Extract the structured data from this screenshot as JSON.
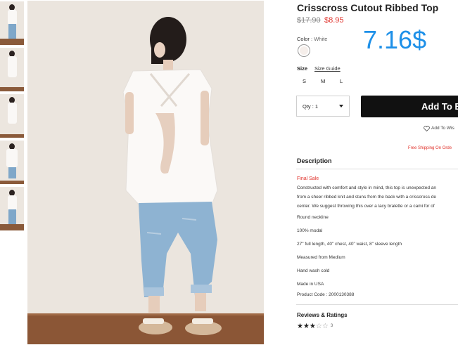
{
  "product": {
    "title": "Crisscross Cutout Ribbed Top",
    "price_original": "$17.90",
    "price_sale": "$8.95",
    "overlay_price": "7.16$",
    "color_label": "Color",
    "color_value": ": White",
    "swatch_color": "#f5eeea",
    "size_label": "Size",
    "size_guide": "Size Guide",
    "sizes": [
      "S",
      "M",
      "L"
    ],
    "qty_label": "Qty : 1",
    "add_button": "Add To B",
    "wishlist": "Add To Wis",
    "free_shipping": "Free Shipping On Orde"
  },
  "description": {
    "title": "Description",
    "final_sale": "Final Sale",
    "lines": [
      "Constructed with comfort and style in mind, this top is unexpected an",
      "from a sheer ribbed knit and stuns from the back with a crisscross de",
      "center. We suggest throwing this over a lacy bralette or a cami for of",
      "Round neckline",
      "100% modal",
      "27\" full length, 40\" chest, 40\" waist, 8\" sleeve length",
      "Measured from Medium",
      "Hand wash cold",
      "Made in USA",
      "Product Code : 2000130388"
    ]
  },
  "reviews": {
    "title": "Reviews & Ratings",
    "stars_on": "★★★",
    "stars_off": "☆☆",
    "rating": 3,
    "count": "3"
  },
  "colors": {
    "accent_red": "#e0312a",
    "overlay_blue": "#1e90e8",
    "button_black": "#111111"
  }
}
